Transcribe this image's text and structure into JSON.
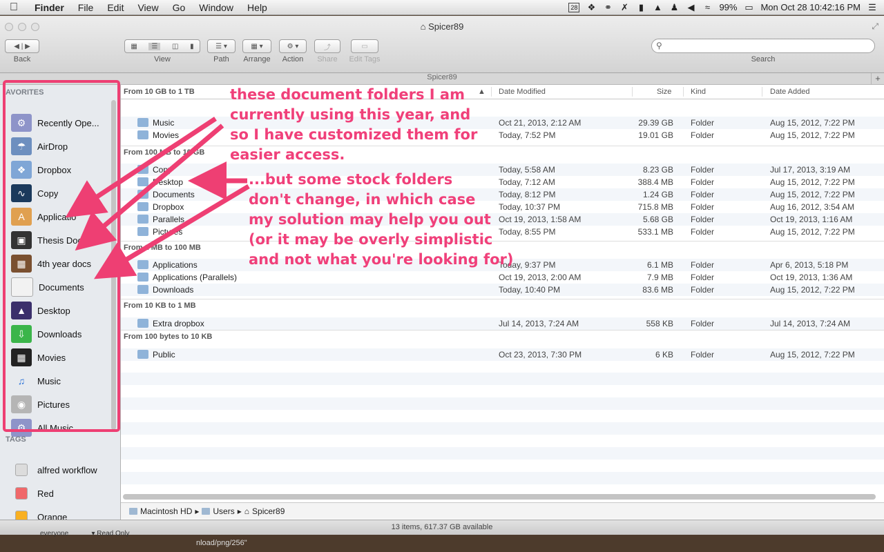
{
  "menubar": {
    "app": "Finder",
    "items": [
      "File",
      "Edit",
      "View",
      "Go",
      "Window",
      "Help"
    ],
    "calendar_day": "28",
    "battery": "99%",
    "datetime": "Mon Oct 28  10:42:16 PM"
  },
  "window": {
    "title": "Spicer89",
    "path_header": "Spicer89",
    "toolbar": {
      "back_label": "Back",
      "view_label": "View",
      "path_label": "Path",
      "arrange_label": "Arrange",
      "action_label": "Action",
      "share_label": "Share",
      "edit_tags_label": "Edit Tags",
      "search_label": "Search",
      "search_placeholder": ""
    }
  },
  "sidebar": {
    "favorites_header": "AVORITES",
    "favorites": [
      {
        "label": "Recently Ope...",
        "icon": "folder-gear-icon"
      },
      {
        "label": "AirDrop",
        "icon": "airdrop-icon"
      },
      {
        "label": "Dropbox",
        "icon": "dropbox-folder-icon"
      },
      {
        "label": "Copy",
        "icon": "copy-app-icon"
      },
      {
        "label": "Applicatio",
        "icon": "applications-icon"
      },
      {
        "label": "Thesis Docs",
        "icon": "briefcase-icon"
      },
      {
        "label": "4th year docs",
        "icon": "books-icon"
      },
      {
        "label": "Documents",
        "icon": "document-icon"
      },
      {
        "label": "Desktop",
        "icon": "desktop-icon"
      },
      {
        "label": "Downloads",
        "icon": "downloads-icon"
      },
      {
        "label": "Movies",
        "icon": "film-icon"
      },
      {
        "label": "Music",
        "icon": "music-note-icon"
      },
      {
        "label": "Pictures",
        "icon": "camera-icon"
      },
      {
        "label": "All Music",
        "icon": "folder-gear-icon"
      }
    ],
    "tags_header": "TAGS",
    "tags": [
      {
        "label": "alfred workflow",
        "color": "#dcdcdc"
      },
      {
        "label": "Red",
        "color": "#f0686a"
      },
      {
        "label": "Orange",
        "color": "#f9b021"
      }
    ]
  },
  "columns": {
    "name": "From 10 GB to 1 TB",
    "date_modified": "Date Modified",
    "size": "Size",
    "kind": "Kind",
    "date_added": "Date Added"
  },
  "groups": [
    {
      "header": "",
      "rows": [
        {
          "name": "Music",
          "modified": "Oct 21, 2013, 2:12 AM",
          "size": "29.39 GB",
          "kind": "Folder",
          "added": "Aug 15, 2012, 7:22 PM"
        },
        {
          "name": "Movies",
          "modified": "Today, 7:52 PM",
          "size": "19.01 GB",
          "kind": "Folder",
          "added": "Aug 15, 2012, 7:22 PM"
        }
      ]
    },
    {
      "header": "From 100 MB to 10 GB",
      "rows": [
        {
          "name": "Copy",
          "modified": "Today, 5:58 AM",
          "size": "8.23 GB",
          "kind": "Folder",
          "added": "Jul 17, 2013, 3:19 AM"
        },
        {
          "name": "Desktop",
          "modified": "Today, 7:12 AM",
          "size": "388.4 MB",
          "kind": "Folder",
          "added": "Aug 15, 2012, 7:22 PM"
        },
        {
          "name": "Documents",
          "modified": "Today, 8:12 PM",
          "size": "1.24 GB",
          "kind": "Folder",
          "added": "Aug 15, 2012, 7:22 PM"
        },
        {
          "name": "Dropbox",
          "modified": "Today, 10:37 PM",
          "size": "715.8 MB",
          "kind": "Folder",
          "added": "Aug 16, 2012, 3:54 AM"
        },
        {
          "name": "Parallels",
          "modified": "Oct 19, 2013, 1:58 AM",
          "size": "5.68 GB",
          "kind": "Folder",
          "added": "Oct 19, 2013, 1:16 AM"
        },
        {
          "name": "Pictures",
          "modified": "Today, 8:55 PM",
          "size": "533.1 MB",
          "kind": "Folder",
          "added": "Aug 15, 2012, 7:22 PM"
        }
      ]
    },
    {
      "header": "From 1 MB to 100 MB",
      "rows": [
        {
          "name": "Applications",
          "modified": "Today, 9:37 PM",
          "size": "6.1 MB",
          "kind": "Folder",
          "added": "Apr 6, 2013, 5:18 PM"
        },
        {
          "name": "Applications (Parallels)",
          "modified": "Oct 19, 2013, 2:00 AM",
          "size": "7.9 MB",
          "kind": "Folder",
          "added": "Oct 19, 2013, 1:36 AM"
        },
        {
          "name": "Downloads",
          "modified": "Today, 10:40 PM",
          "size": "83.6 MB",
          "kind": "Folder",
          "added": "Aug 15, 2012, 7:22 PM"
        }
      ]
    },
    {
      "header": "From 10 KB to 1 MB",
      "rows": [
        {
          "name": "Extra dropbox",
          "modified": "Jul 14, 2013, 7:24 AM",
          "size": "558 KB",
          "kind": "Folder",
          "added": "Jul 14, 2013, 7:24 AM"
        }
      ]
    },
    {
      "header": "From 100 bytes to 10 KB",
      "rows": [
        {
          "name": "Public",
          "modified": "Oct 23, 2013, 7:30 PM",
          "size": "6 KB",
          "kind": "Folder",
          "added": "Aug 15, 2012, 7:22 PM"
        }
      ]
    }
  ],
  "pathbar": [
    "Macintosh HD",
    "Users",
    "Spicer89"
  ],
  "status": "13 items, 617.37 GB available",
  "background": {
    "text1": "nload/png/256\"",
    "text2": "everyone",
    "text3": "Read Only"
  },
  "annotations": {
    "note1": [
      "these document folders I am",
      "currently using this year, and",
      "so I have customized them for",
      "easier access."
    ],
    "note2": [
      "...but some stock folders",
      "don't change, in which case",
      "my solution may help you out",
      "(or it may be overly simplistic",
      "and not what you're looking for)"
    ],
    "color": "#f0407a"
  }
}
